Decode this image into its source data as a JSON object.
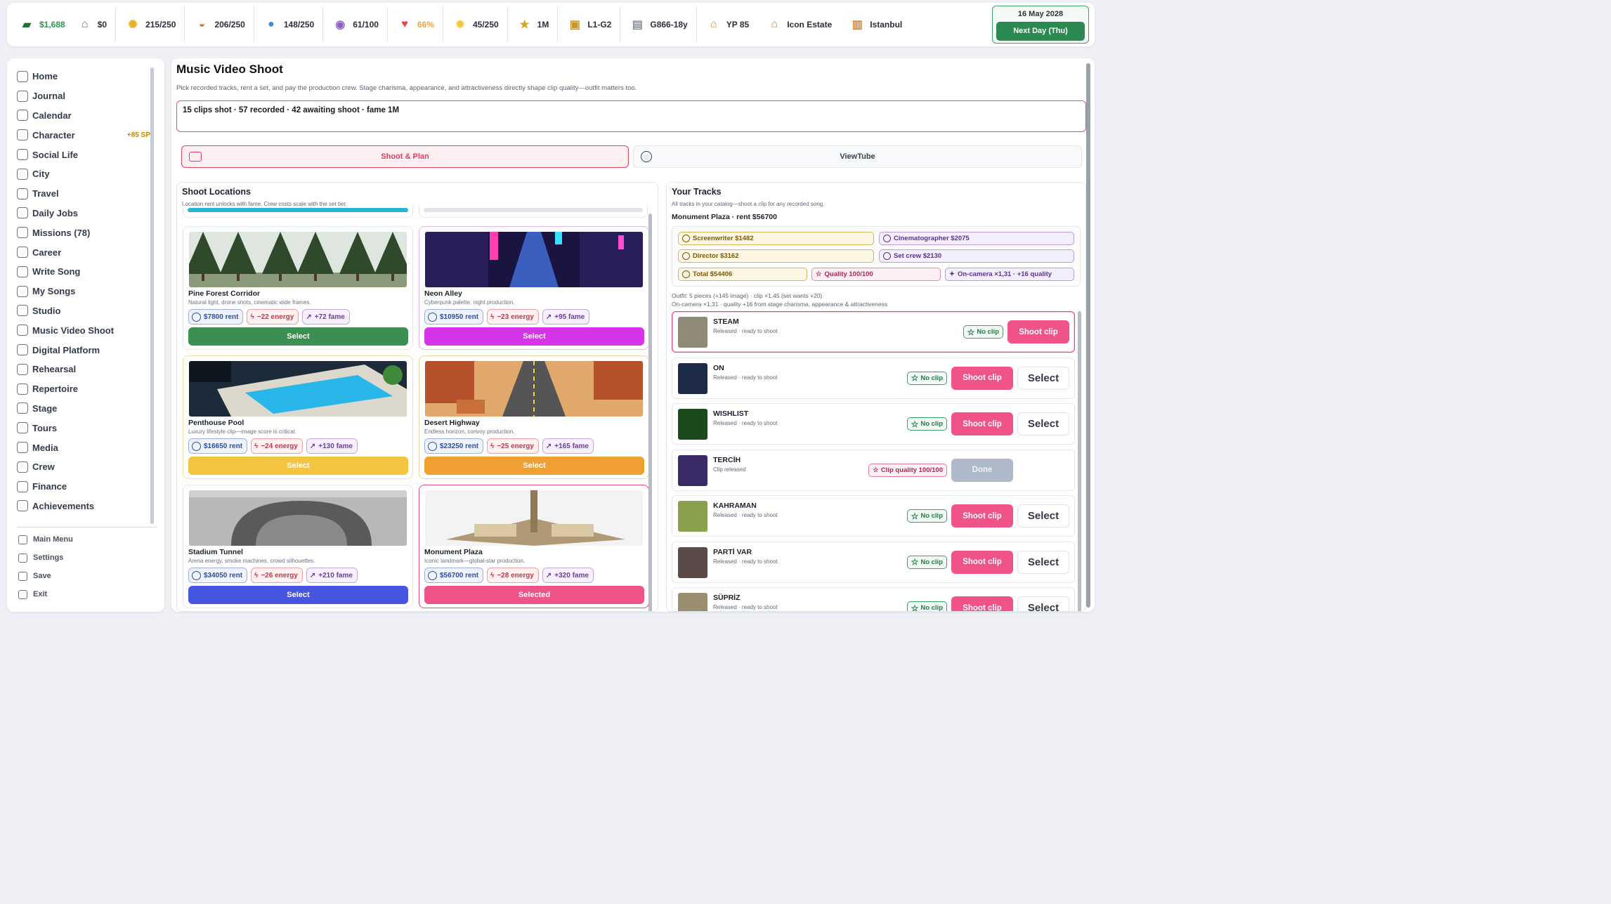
{
  "topbar": {
    "stats": [
      {
        "name": "cash",
        "icon": "cash-icon",
        "value": "$1,688",
        "color": "#2a9a4e"
      },
      {
        "name": "bank",
        "icon": "bank-icon",
        "value": "$0",
        "color": "#2a2f3a"
      },
      {
        "name": "energy",
        "icon": "energy-icon",
        "value": "215/250",
        "color": "#2a2f3a"
      },
      {
        "name": "food",
        "icon": "burger-icon",
        "value": "206/250",
        "color": "#2a2f3a"
      },
      {
        "name": "water",
        "icon": "water-drop-icon",
        "value": "148/250",
        "color": "#2a2f3a"
      },
      {
        "name": "mood",
        "icon": "mood-icon",
        "value": "61/100",
        "color": "#2a2f3a"
      },
      {
        "name": "health",
        "icon": "heart-icon",
        "value": "66%",
        "color": "#f0a44a"
      },
      {
        "name": "idea",
        "icon": "lightbulb-icon",
        "value": "45/250",
        "color": "#2a2f3a"
      },
      {
        "name": "fame",
        "icon": "star-icon",
        "value": "1M",
        "color": "#2a2f3a"
      },
      {
        "name": "level",
        "icon": "level-icon",
        "value": "L1-G2",
        "color": "#2a2f3a"
      },
      {
        "name": "vehicle",
        "icon": "car-icon",
        "value": "G866-18y",
        "color": "#2a2f3a"
      },
      {
        "name": "yp",
        "icon": "house-icon",
        "value": "YP 85",
        "color": "#2a2f3a"
      },
      {
        "name": "estate",
        "icon": "estate-icon",
        "value": "Icon Estate",
        "color": "#2a2f3a"
      },
      {
        "name": "city",
        "icon": "city-icon",
        "value": "Istanbul",
        "color": "#2a2f3a"
      }
    ],
    "date": "16 May 2028",
    "next_day": "Next Day (Thu)"
  },
  "sidebar": {
    "items": [
      {
        "label": "Home",
        "icon": "home-icon"
      },
      {
        "label": "Journal",
        "icon": "journal-icon"
      },
      {
        "label": "Calendar",
        "icon": "calendar-icon"
      },
      {
        "label": "Character",
        "icon": "sparkles-icon",
        "badge": "+85 SP"
      },
      {
        "label": "Social Life",
        "icon": "people-icon"
      },
      {
        "label": "City",
        "icon": "pulse-icon"
      },
      {
        "label": "Travel",
        "icon": "suitcase-icon"
      },
      {
        "label": "Daily Jobs",
        "icon": "link-icon"
      },
      {
        "label": "Missions (78)",
        "icon": "flame-icon"
      },
      {
        "label": "Career",
        "icon": "trend-icon"
      },
      {
        "label": "Write Song",
        "icon": "music-note-icon"
      },
      {
        "label": "My Songs",
        "icon": "disc-icon"
      },
      {
        "label": "Studio",
        "icon": "radio-icon"
      },
      {
        "label": "Music Video Shoot",
        "icon": "camera-icon"
      },
      {
        "label": "Digital Platform",
        "icon": "broadcast-icon"
      },
      {
        "label": "Rehearsal",
        "icon": "mic-icon"
      },
      {
        "label": "Repertoire",
        "icon": "music-note-icon"
      },
      {
        "label": "Stage",
        "icon": "target-icon"
      },
      {
        "label": "Tours",
        "icon": "bus-icon"
      },
      {
        "label": "Media",
        "icon": "camera-icon"
      },
      {
        "label": "Crew",
        "icon": "people-icon"
      },
      {
        "label": "Finance",
        "icon": "link-icon"
      },
      {
        "label": "Achievements",
        "icon": "trophy-icon"
      }
    ],
    "bottom": [
      {
        "label": "Main Menu",
        "icon": "home-icon"
      },
      {
        "label": "Settings",
        "icon": "pulse-icon"
      },
      {
        "label": "Save",
        "icon": "disc-icon"
      },
      {
        "label": "Exit",
        "icon": "flame-icon"
      }
    ]
  },
  "main": {
    "title": "Music Video Shoot",
    "subtitle": "Pick recorded tracks, rent a set, and pay the production crew. Stage charisma, appearance, and attractiveness directly shape clip quality—outfit matters too.",
    "info": "15 clips shot · 57 recorded · 42 awaiting shoot · fame 1M",
    "tabs": [
      {
        "label": "Shoot & Plan",
        "icon": "camera-icon"
      },
      {
        "label": "ViewTube",
        "icon": "broadcast-icon"
      }
    ]
  },
  "locations": {
    "title": "Shoot Locations",
    "subtitle": "Location rent unlocks with fame. Crew costs scale with the set tier.",
    "cards": [
      {
        "name": "Pine Forest Corridor",
        "desc": "Natural light, drone shots, cinematic wide frames.",
        "rent": "$7800 rent",
        "energy": "−22 energy",
        "fame": "+72 fame",
        "button": "Select",
        "color": "#3b8f52",
        "img": "forest"
      },
      {
        "name": "Neon Alley",
        "desc": "Cyberpunk palette, night production.",
        "rent": "$10950 rent",
        "energy": "−23 energy",
        "fame": "+95 fame",
        "button": "Select",
        "color": "#d534e8",
        "img": "neon"
      },
      {
        "name": "Penthouse Pool",
        "desc": "Luxury lifestyle clip—image score is critical.",
        "rent": "$16650 rent",
        "energy": "−24 energy",
        "fame": "+130 fame",
        "button": "Select",
        "color": "#f2c440",
        "img": "pool"
      },
      {
        "name": "Desert Highway",
        "desc": "Endless horizon, convoy production.",
        "rent": "$23250 rent",
        "energy": "−25 energy",
        "fame": "+165 fame",
        "button": "Select",
        "color": "#eea030",
        "img": "desert"
      },
      {
        "name": "Stadium Tunnel",
        "desc": "Arena energy, smoke machines, crowd silhouettes.",
        "rent": "$34050 rent",
        "energy": "−26 energy",
        "fame": "+210 fame",
        "button": "Select",
        "color": "#4656e0",
        "img": "tunnel"
      },
      {
        "name": "Monument Plaza",
        "desc": "Iconic landmark—global-star production.",
        "rent": "$56700 rent",
        "energy": "−28 energy",
        "fame": "+320 fame",
        "button": "Selected",
        "color": "#f0528a",
        "img": "plaza"
      }
    ]
  },
  "tracks": {
    "title": "Your Tracks",
    "subtitle": "All tracks in your catalog—shoot a clip for any recorded song.",
    "selected_location": "Monument Plaza · rent $56700",
    "crew": {
      "screenwriter": "Screenwriter $1482",
      "cinematographer": "Cinematographer $2075",
      "director": "Director $3162",
      "set_crew": "Set crew $2130",
      "total": "Total $54406",
      "quality": "Quality 100/100",
      "oncamera": "On-camera ×1,31 · +16 quality"
    },
    "outfit_line1": "Outfit: 5 pieces (+145 image) · clip ×1,45 (set wants +20)",
    "outfit_line2": "On-camera ×1,31 · quality +16 from stage charisma, appearance & attractiveness",
    "list": [
      {
        "name": "STEAM",
        "status": "Released · ready to shoot",
        "badge": "No clip",
        "action": "Shoot clip",
        "select": "",
        "thumb": "#8f8a78"
      },
      {
        "name": "ON",
        "status": "Released · ready to shoot",
        "badge": "No clip",
        "action": "Shoot clip",
        "select": "Select",
        "thumb": "#1d2a4a"
      },
      {
        "name": "WISHLIST",
        "status": "Released · ready to shoot",
        "badge": "No clip",
        "action": "Shoot clip",
        "select": "Select",
        "thumb": "#1a4a1e"
      },
      {
        "name": "TERCİH",
        "status": "Clip released",
        "badge": "Clip quality 100/100",
        "action": "Done",
        "select": "",
        "thumb": "#3a2a66"
      },
      {
        "name": "KAHRAMAN",
        "status": "Released · ready to shoot",
        "badge": "No clip",
        "action": "Shoot clip",
        "select": "Select",
        "thumb": "#8aa04a"
      },
      {
        "name": "PARTİ VAR",
        "status": "Released · ready to shoot",
        "badge": "No clip",
        "action": "Shoot clip",
        "select": "Select",
        "thumb": "#5a4a48"
      },
      {
        "name": "SÜPRİZ",
        "status": "Released · ready to shoot",
        "badge": "No clip",
        "action": "Shoot clip",
        "select": "Select",
        "thumb": "#9a8e70"
      }
    ]
  }
}
